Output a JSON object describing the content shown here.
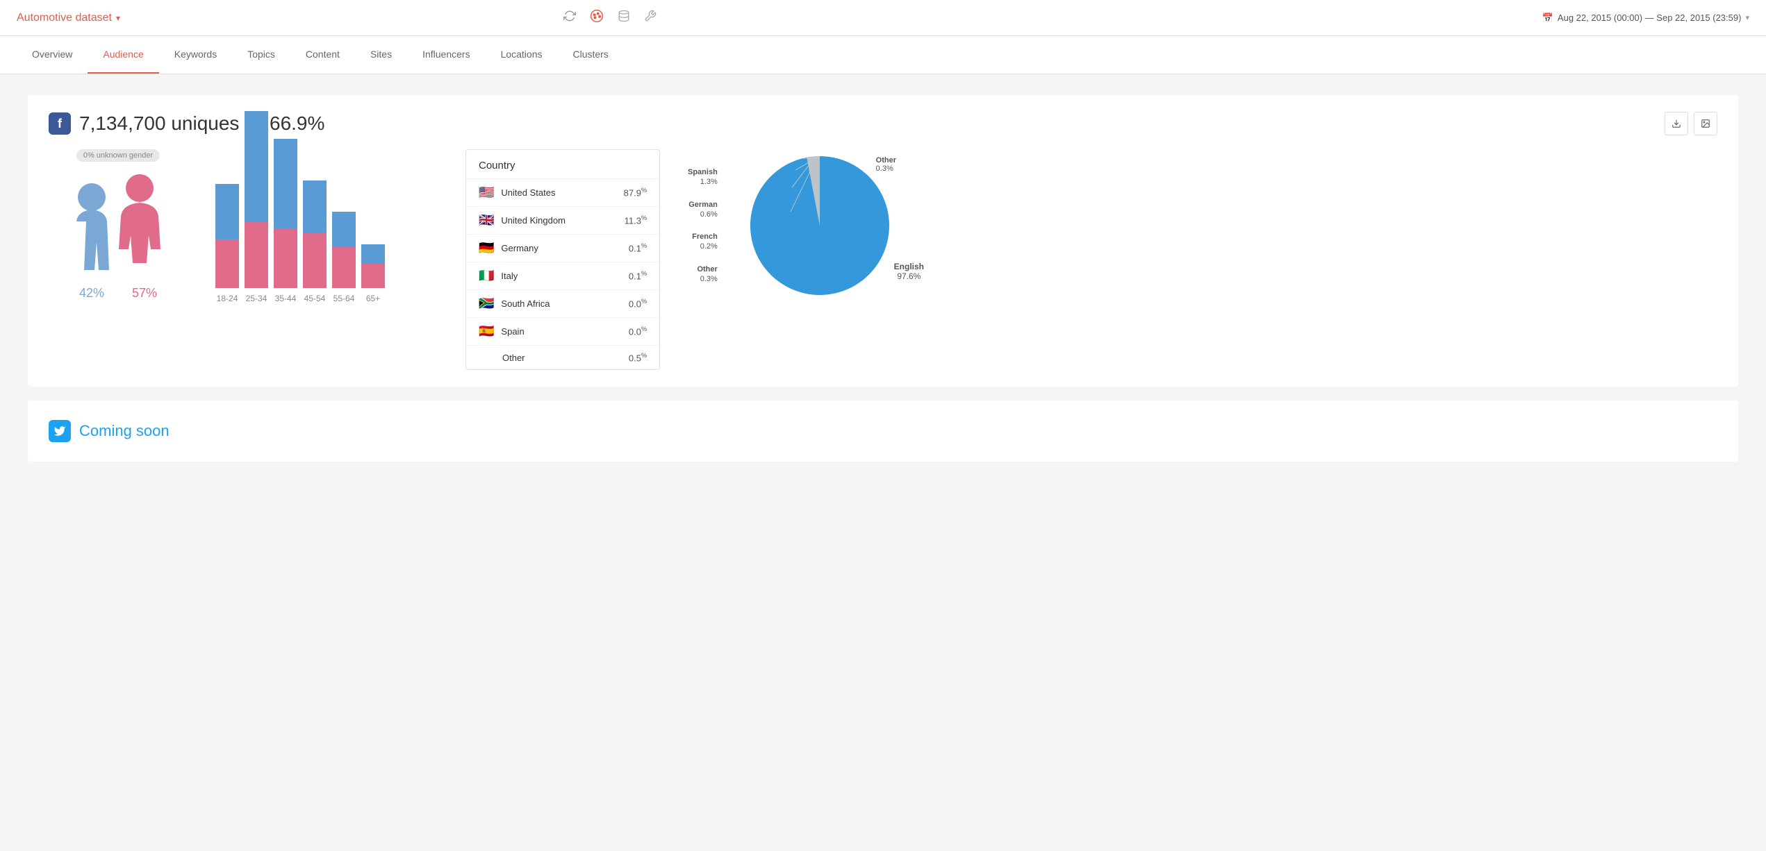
{
  "app": {
    "title": "Automotive dataset",
    "arrow": "▾"
  },
  "header": {
    "icons": [
      "refresh",
      "palette",
      "database",
      "wrench"
    ],
    "date_range": "Aug 22, 2015 (00:00) — Sep 22, 2015 (23:59)"
  },
  "nav": {
    "items": [
      "Overview",
      "Audience",
      "Keywords",
      "Topics",
      "Content",
      "Sites",
      "Influencers",
      "Locations",
      "Clusters"
    ],
    "active": "Audience"
  },
  "facebook": {
    "uniques": "7,134,700 uniques",
    "dash": "—",
    "percentage": "66.9%",
    "unknown_gender": "0% unknown gender",
    "male_pct": "42%",
    "female_pct": "57%",
    "age_groups": [
      "18-24",
      "25-34",
      "35-44",
      "45-54",
      "55-64",
      "65+"
    ],
    "bars": [
      {
        "male": 80,
        "female": 70
      },
      {
        "male": 160,
        "female": 95
      },
      {
        "male": 130,
        "female": 85
      },
      {
        "male": 75,
        "female": 80
      },
      {
        "male": 50,
        "female": 60
      },
      {
        "male": 28,
        "female": 35
      }
    ],
    "country_title": "Country",
    "countries": [
      {
        "flag": "🇺🇸",
        "name": "United States",
        "pct": "87.9%"
      },
      {
        "flag": "🇬🇧",
        "name": "United Kingdom",
        "pct": "11.3%"
      },
      {
        "flag": "🇩🇪",
        "name": "Germany",
        "pct": "0.1%"
      },
      {
        "flag": "🇮🇹",
        "name": "Italy",
        "pct": "0.1%"
      },
      {
        "flag": "🇿🇦",
        "name": "South Africa",
        "pct": "0.0%"
      },
      {
        "flag": "🇪🇸",
        "name": "Spain",
        "pct": "0.0%"
      },
      {
        "name": "Other",
        "pct": "0.5%"
      }
    ],
    "languages": [
      {
        "name": "English",
        "pct": 97.6,
        "color": "#3498db",
        "label": "English\n97.6%",
        "position": "bottom-right"
      },
      {
        "name": "Spanish",
        "pct": 1.3,
        "color": "#e67e22",
        "label": "Spanish\n1.3%"
      },
      {
        "name": "German",
        "pct": 0.6,
        "color": "#27ae60",
        "label": "German\n0.6%"
      },
      {
        "name": "French",
        "pct": 0.2,
        "color": "#95a5a6",
        "label": "French\n0.2%"
      },
      {
        "name": "Other",
        "pct": 0.3,
        "color": "#bdc3c7",
        "label": "Other\n0.3%"
      }
    ]
  },
  "twitter": {
    "coming_soon": "Coming soon"
  },
  "buttons": {
    "download": "⬇",
    "image": "🖼"
  }
}
